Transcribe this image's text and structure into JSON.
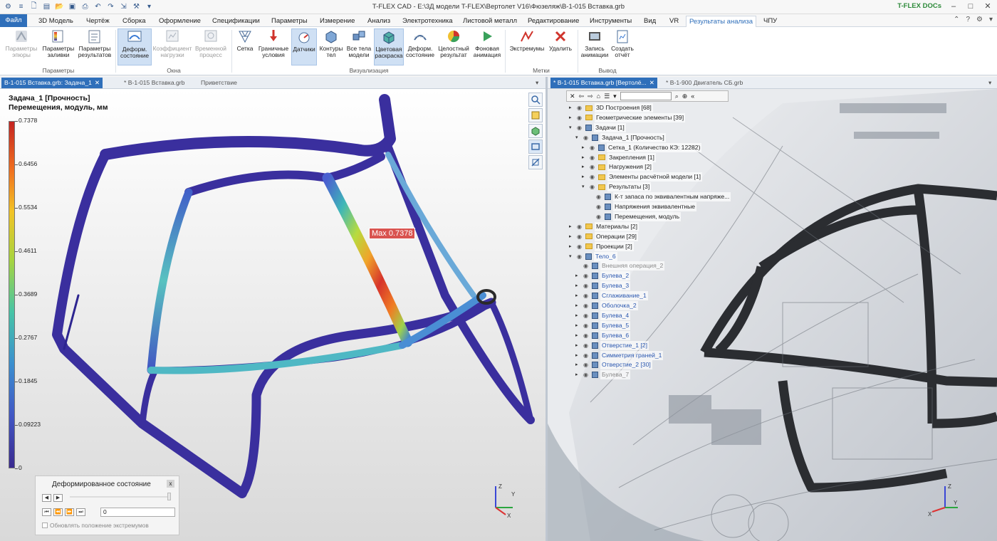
{
  "window": {
    "title": "T-FLEX CAD - E:\\3Д модели T-FLEX\\Вертолет V16\\Фюзеляж\\В-1-015 Вставка.grb",
    "docs_label": "T-FLEX DOCs",
    "min": "–",
    "max": "□",
    "close": "✕"
  },
  "tabs": [
    {
      "label": "Файл"
    },
    {
      "label": "3D Модель"
    },
    {
      "label": "Чертёж"
    },
    {
      "label": "Сборка"
    },
    {
      "label": "Оформление"
    },
    {
      "label": "Спецификации"
    },
    {
      "label": "Параметры"
    },
    {
      "label": "Измерение"
    },
    {
      "label": "Анализ"
    },
    {
      "label": "Электротехника"
    },
    {
      "label": "Листовой металл"
    },
    {
      "label": "Редактирование"
    },
    {
      "label": "Инструменты"
    },
    {
      "label": "Вид"
    },
    {
      "label": "VR"
    },
    {
      "label": "Результаты анализа"
    },
    {
      "label": "ЧПУ"
    }
  ],
  "ribbon": {
    "buttons": [
      {
        "l1": "Параметры",
        "l2": "эпюры"
      },
      {
        "l1": "Параметры",
        "l2": "заливки"
      },
      {
        "l1": "Параметры",
        "l2": "результатов"
      },
      {
        "l1": "Деформ.",
        "l2": "состояние"
      },
      {
        "l1": "Коэффициент",
        "l2": "нагрузки"
      },
      {
        "l1": "Временной",
        "l2": "процесс"
      },
      {
        "l1": "Сетка",
        "l2": ""
      },
      {
        "l1": "Граничные",
        "l2": "условия"
      },
      {
        "l1": "Датчики",
        "l2": ""
      },
      {
        "l1": "Контуры",
        "l2": "тел"
      },
      {
        "l1": "Все тела",
        "l2": "модели"
      },
      {
        "l1": "Цветовая",
        "l2": "раскраска"
      },
      {
        "l1": "Деформ.",
        "l2": "состояние"
      },
      {
        "l1": "Целостный",
        "l2": "результат"
      },
      {
        "l1": "Фоновая",
        "l2": "анимация"
      },
      {
        "l1": "Экстремумы",
        "l2": ""
      },
      {
        "l1": "Удалить",
        "l2": ""
      },
      {
        "l1": "Запись",
        "l2": "анимации"
      },
      {
        "l1": "Создать",
        "l2": "отчёт"
      }
    ],
    "groups": [
      "Параметры",
      "Окна",
      "Визуализация",
      "Метки",
      "Вывод"
    ]
  },
  "doc_tabs_left": [
    "В-1-015 Вставка.grb: Задача_1",
    "* В-1-015 Вставка.grb",
    "Приветствие"
  ],
  "doc_tabs_right": [
    "* В-1-015 Вставка.grb [Вертолё...",
    "* В-1-900 Двигатель СБ.grb"
  ],
  "viewport": {
    "title_line1": "Задача_1 [Прочность]",
    "title_line2": "Перемещения, модуль, мм",
    "legend_ticks": [
      "0.7378",
      "0.6456",
      "0.5534",
      "0.4611",
      "0.3689",
      "0.2767",
      "0.1845",
      "0.09223",
      "0"
    ],
    "max_label": "Max 0.7378",
    "axes": {
      "x": "X",
      "y": "Y",
      "z": "Z"
    }
  },
  "deform_panel": {
    "title": "Деформированное состояние",
    "close": "x",
    "value": "0",
    "checkbox_label": "Обновлять положение экстремумов"
  },
  "tree": {
    "items": [
      {
        "label": "3D Построения [68]"
      },
      {
        "label": "Геометрические элементы [39]"
      },
      {
        "label": "Задачи [1]"
      },
      {
        "label": "Задача_1 [Прочность]"
      },
      {
        "label": "Сетка_1 (Количество КЭ: 12282)"
      },
      {
        "label": "Закрепления [1]"
      },
      {
        "label": "Нагружения [2]"
      },
      {
        "label": "Элементы расчётной модели [1]"
      },
      {
        "label": "Результаты [3]"
      },
      {
        "label": "К-т запаса по эквивалентным напряже..."
      },
      {
        "label": "Напряжения эквивалентные"
      },
      {
        "label": "Перемещения, модуль"
      },
      {
        "label": "Материалы [2]"
      },
      {
        "label": "Операции [29]"
      },
      {
        "label": "Проекции [2]"
      },
      {
        "label": "Тело_6"
      },
      {
        "label": "Внешняя операция_2"
      },
      {
        "label": "Булева_2"
      },
      {
        "label": "Булева_3"
      },
      {
        "label": "Сглаживание_1"
      },
      {
        "label": "Оболочка_2"
      },
      {
        "label": "Булева_4"
      },
      {
        "label": "Булева_5"
      },
      {
        "label": "Булева_6"
      },
      {
        "label": "Отверстие_1 [2]"
      },
      {
        "label": "Симметрия граней_1"
      },
      {
        "label": "Отверстие_2 [30]"
      },
      {
        "label": "Булева_7"
      }
    ]
  },
  "colors": {
    "accent": "#2f6fba",
    "mesh_body": "#3a2f9e",
    "max_label_bg": "#d9534f"
  }
}
